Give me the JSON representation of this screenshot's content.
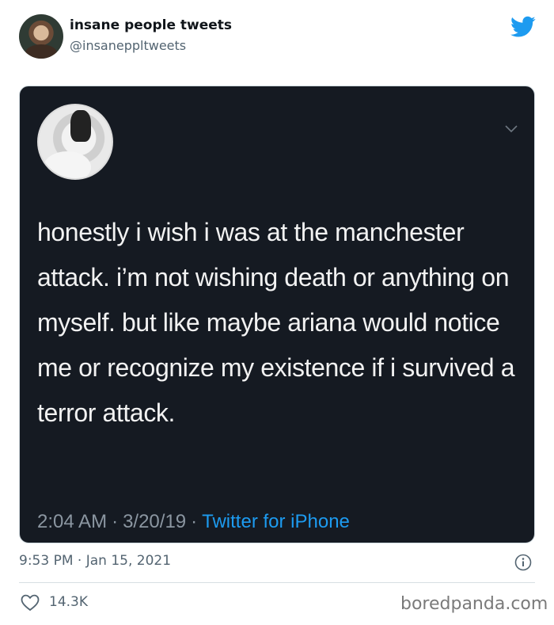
{
  "author": {
    "display_name": "insane people tweets",
    "handle": "@insanеppltweets"
  },
  "embedded_tweet": {
    "text": "honestly i wish i was at the manchester attack. i’m not wishing death or anything on myself. but like maybe ariana would notice me or recognize my existence if i survived a terror attack.",
    "time": "2:04 AM",
    "date": "3/20/19",
    "source": "Twitter for iPhone"
  },
  "tweet_meta": {
    "timestamp": "9:53 PM · Jan 15, 2021",
    "likes": "14.3K"
  },
  "watermark": "boredpanda.com",
  "icons": {
    "bird": "twitter-bird-icon",
    "info": "info-icon",
    "heart": "heart-icon",
    "chevron": "chevron-down-icon"
  },
  "colors": {
    "twitter_blue": "#1d9bf0",
    "card_bg": "#151a22",
    "muted_text": "#536471"
  }
}
